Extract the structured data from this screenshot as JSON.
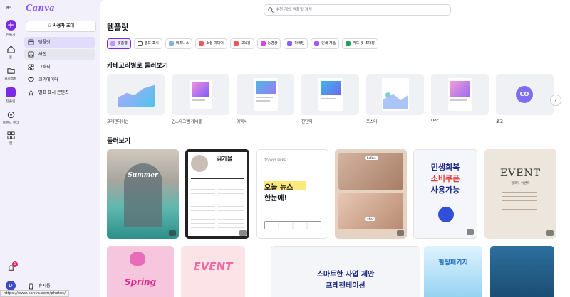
{
  "rail": {
    "create": "만들기",
    "home": "홈",
    "projects": "프로젝트",
    "templates": "템플릿",
    "brand": "브랜드 센터",
    "apps": "앱",
    "notification_count": "1",
    "avatar_letter": "D"
  },
  "panel": {
    "logo": "Canva",
    "invite": "사용자 초대",
    "nav": [
      "템플릿",
      "사진",
      "그래픽",
      "크리에이터",
      "별표 표시 콘텐츠"
    ],
    "trash": "휴지통"
  },
  "main": {
    "search_placeholder": "수천 개의 템플릿 검색",
    "title": "템플릿",
    "chips": [
      "맞춤형",
      "별표 표시",
      "비즈니스",
      "소셜 미디어",
      "교육용",
      "동영상",
      "마케팅",
      "인쇄 제품",
      "카드 및 초대장"
    ],
    "categories_heading": "카테고리별로 둘러보기",
    "categories": [
      "프레젠테이션",
      "인스타그램 게시물",
      "이력서",
      "전단지",
      "포스터",
      "Doc",
      "로고"
    ],
    "logo_thumb_text": "CO",
    "browse_heading": "둘러보기"
  },
  "cards": {
    "c1_title": "Summer",
    "c2_title": "김가을",
    "c3_pre": "TODAY'S PICKS",
    "c3_main1": "오늘 뉴스",
    "c3_main2": "한눈에!",
    "c4_tag1": "before",
    "c4_tag2": "after",
    "c5_l1": "민생회복",
    "c5_l2": "소비쿠폰",
    "c5_l3": "사용가능",
    "c6_title": "EVENT",
    "c6_sub": "할로우 이벤트",
    "c7_title": "Spring",
    "c8_title": "EVENT",
    "c9_title": "스마트한 사업 제안",
    "c9_sub": "프레젠테이션",
    "c10_title": "힐링패키지"
  },
  "status_url": "https://www.canva.com/photos/",
  "help": "?",
  "colors": {
    "brand": "#7d2ae8",
    "active_nav": "#e1dcfb",
    "panel_bg": "#f2f1fb"
  }
}
